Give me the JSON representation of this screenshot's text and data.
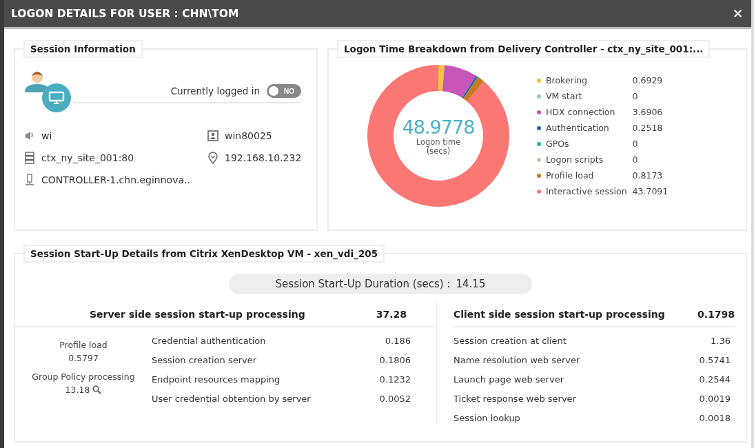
{
  "window": {
    "title": "LOGON DETAILS FOR USER : CHN\\TOM",
    "close": "✕"
  },
  "session_info": {
    "title": "Session Information",
    "status": {
      "label": "Currently logged in",
      "on": false,
      "text": "NO"
    },
    "fields": [
      {
        "kind": "client",
        "value": "wi"
      },
      {
        "kind": "machine",
        "value": "win80025"
      },
      {
        "kind": "server",
        "value": "ctx_ny_site_001:80"
      },
      {
        "kind": "location",
        "value": "192.168.10.232"
      },
      {
        "kind": "controller",
        "value": "CONTROLLER-1.chn.eginnova.."
      }
    ]
  },
  "logon_breakdown": {
    "title": "Logon Time Breakdown from Delivery Controller - ctx_ny_site_001:...",
    "total": "48.9778",
    "total_label": "Logon time",
    "total_unit": "(secs)",
    "chart_data": {
      "type": "donut",
      "categories": [
        "Brokering",
        "VM start",
        "HDX connection",
        "Authentication",
        "GPOs",
        "Logon scripts",
        "Profile load",
        "Interactive session"
      ],
      "values": [
        1.409,
        0,
        7.507,
        0.512,
        0,
        0,
        1.662,
        88.91
      ]
    },
    "legend": [
      {
        "value": "0.6929",
        "color": "#f5c342"
      },
      {
        "value": "0",
        "color": "#8fd3c1"
      },
      {
        "value": "3.6906",
        "color": "#c855b8"
      },
      {
        "value": "0.2518",
        "color": "#2366b0"
      },
      {
        "value": "0",
        "color": "#27b5b8"
      },
      {
        "value": "0",
        "color": "#b5d69a"
      },
      {
        "value": "0.8173",
        "color": "#c87a1e"
      },
      {
        "value": "43.7091",
        "color": "#fb7774"
      }
    ]
  },
  "startup": {
    "title": "Session Start-Up Details from Citrix XenDesktop VM - xen_vdi_205",
    "duration_label": "Session Start-Up Duration (secs) :",
    "duration": "14.15",
    "server": {
      "title": "Server side session start-up processing",
      "total": "37.28",
      "summary": [
        {
          "kind": "plain",
          "label": "Profile load",
          "value": "0.5797"
        },
        {
          "kind": "drilldown",
          "label": "Group Policy processing",
          "value": "13.18"
        }
      ],
      "rows": [
        {
          "label": "Credential authentication",
          "value": "0.186"
        },
        {
          "label": "Session creation server",
          "value": "0.1806"
        },
        {
          "label": "Endpoint resources mapping",
          "value": "0.1232"
        },
        {
          "label": "User credential obtention by server",
          "value": "0.0052"
        }
      ]
    },
    "client": {
      "title": "Client side session start-up processing",
      "total": "0.1798",
      "rows": [
        {
          "label": "Session creation at client",
          "value": "1.36"
        },
        {
          "label": "Name resolution web server",
          "value": "0.5741"
        },
        {
          "label": "Launch page web server",
          "value": "0.2544"
        },
        {
          "label": "Ticket response web server",
          "value": "0.0019"
        },
        {
          "label": "Session lookup",
          "value": "0.0018"
        }
      ]
    }
  }
}
